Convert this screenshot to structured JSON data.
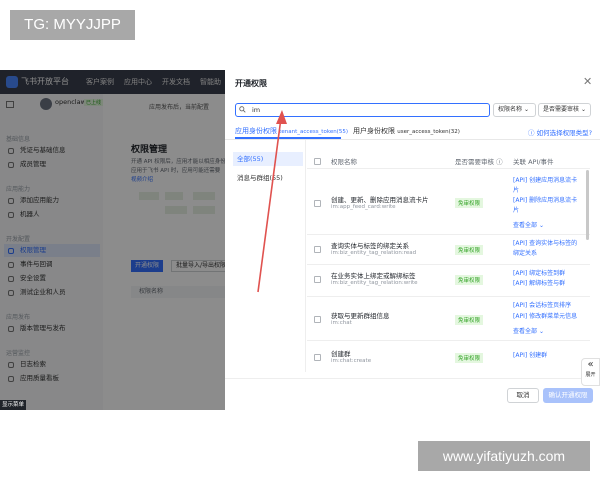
{
  "watermarks": {
    "top": "TG: MYYJJPP",
    "bottom": "www.yifatiyuzh.com"
  },
  "topbar": {
    "brand": "飞书开放平台",
    "nav": [
      "客户案例",
      "应用中心",
      "开发文档",
      "智能助"
    ]
  },
  "app": {
    "name": "openclaw",
    "badge": "已上线",
    "notice": "应用发布后，当前配置"
  },
  "sidebar": {
    "groups": [
      {
        "title": "基础信息",
        "items": [
          {
            "label": "凭证与基础信息"
          },
          {
            "label": "成员管理"
          }
        ]
      },
      {
        "title": "应用能力",
        "items": [
          {
            "label": "添加应用能力"
          },
          {
            "label": "机器人"
          }
        ]
      },
      {
        "title": "开发配置",
        "items": [
          {
            "label": "权限管理",
            "active": true
          },
          {
            "label": "事件与回调"
          },
          {
            "label": "安全设置"
          },
          {
            "label": "测试企业和人员"
          }
        ]
      },
      {
        "title": "应用发布",
        "items": [
          {
            "label": "版本管理与发布"
          }
        ]
      },
      {
        "title": "运营监控",
        "items": [
          {
            "label": "日志检索"
          },
          {
            "label": "应用质量看板"
          }
        ]
      }
    ],
    "status_strip": "显示菜单"
  },
  "page": {
    "title": "权限管理",
    "desc1": "开通 API 权限后，应用才能以相应身份",
    "desc2": "应用于飞书 API 时，应用可能还需要",
    "link": "视频介绍",
    "btn_primary": "开通权限",
    "btn_secondary": "批量导入/导出权限",
    "table_header": "权限名称"
  },
  "modal": {
    "title": "开通权限",
    "close_icon": "close-icon",
    "search": {
      "value": "im",
      "icon": "search-icon"
    },
    "select_permission": "权限名称",
    "select_review": "是否需要审核",
    "tabs": [
      {
        "label": "应用身份权限",
        "sub": "tenant_access_token(55)"
      },
      {
        "label": "用户身份权限",
        "sub": "user_access_token(32)"
      }
    ],
    "help": "如何选择权限类型?",
    "categories": [
      {
        "label": "全部(55)",
        "active": true
      },
      {
        "label": "消息与群组(55)"
      }
    ],
    "headers": {
      "name": "权限名称",
      "review": "是否需要审核",
      "api": "关联 API/事件"
    },
    "rows": [
      {
        "name": "创建、更新、删除应用消息流卡片",
        "code": "im:app_feed_card:write",
        "review": "免审权限",
        "apis": [
          "[API] 创建应用消息流卡",
          "片",
          "[API] 删除应用消息流卡",
          "片"
        ],
        "more": "查看全部"
      },
      {
        "name": "查询实体与标签的绑定关系",
        "code": "im:biz_entity_tag_relation:read",
        "review": "免审权限",
        "apis": [
          "[API] 查询实体与标签的",
          "绑定关系"
        ]
      },
      {
        "name": "在业务实体上绑定或解绑标签",
        "code": "im:biz_entity_tag_relation:write",
        "review": "免审权限",
        "apis": [
          "[API] 绑定标签到群",
          "[API] 解绑标签与群"
        ]
      },
      {
        "name": "获取与更新群组信息",
        "code": "im:chat",
        "review": "免审权限",
        "apis": [
          "[API] 会话标签页排序",
          "[API] 修改群菜单元信息"
        ],
        "more": "查看全部"
      },
      {
        "name": "创建群",
        "code": "im:chat:create",
        "review": "免审权限",
        "apis": [
          "[API] 创建群"
        ]
      }
    ],
    "footer": {
      "cancel": "取消",
      "confirm": "确认开通权限"
    },
    "expand": {
      "label": "展开",
      "icon": "double-chevron-left-icon"
    }
  },
  "colors": {
    "accent": "#3370ff",
    "tag_green": "#2ea121",
    "arrow": "#e0524f"
  }
}
